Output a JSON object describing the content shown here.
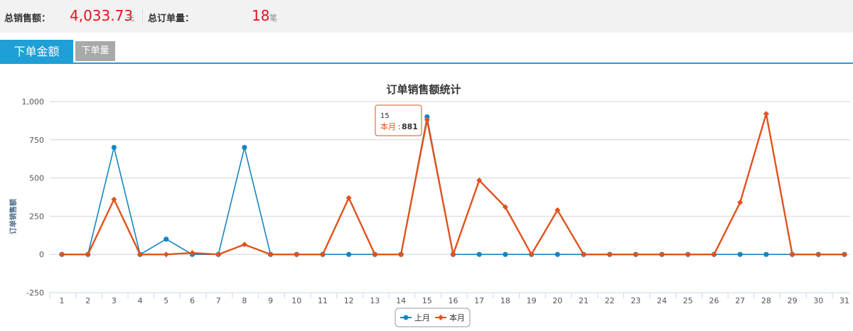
{
  "summary": {
    "total_sales_label": "总销售额：",
    "total_sales_value": "4,033.73",
    "total_sales_unit": "元",
    "total_orders_label": "总订单量：",
    "total_orders_value": "18",
    "total_orders_unit": "笔"
  },
  "tabs": {
    "amount": "下单金额",
    "count": "下单量"
  },
  "colors": {
    "last_month": "#1786c0",
    "this_month": "#e2521d",
    "accent": "#1e9fd6",
    "highlight": "#e0141c"
  },
  "tooltip": {
    "x": "15",
    "series": "本月",
    "value": "881"
  },
  "chart_data": {
    "type": "line",
    "title": "订单销售额统计",
    "ylabel": "订单销售额",
    "xlabel": "",
    "ylim": [
      -250,
      1000
    ],
    "yticks": [
      -250,
      0,
      250,
      500,
      750,
      1000
    ],
    "ytick_labels": [
      "-250",
      "0",
      "250",
      "500",
      "750",
      "1,000"
    ],
    "categories": [
      "1",
      "2",
      "3",
      "4",
      "5",
      "6",
      "7",
      "8",
      "9",
      "10",
      "11",
      "12",
      "13",
      "14",
      "15",
      "16",
      "17",
      "18",
      "19",
      "20",
      "21",
      "22",
      "23",
      "24",
      "25",
      "26",
      "27",
      "28",
      "29",
      "30",
      "31"
    ],
    "grid": true,
    "legend_position": "bottom-center",
    "series": [
      {
        "name": "上月",
        "marker": "circle",
        "values": [
          0,
          0,
          700,
          0,
          100,
          0,
          0,
          700,
          0,
          0,
          0,
          0,
          0,
          0,
          900,
          0,
          0,
          0,
          0,
          0,
          0,
          0,
          0,
          0,
          0,
          0,
          0,
          0,
          0,
          0,
          0
        ]
      },
      {
        "name": "本月",
        "marker": "diamond",
        "values": [
          0,
          0,
          360,
          0,
          0,
          10,
          0,
          65,
          0,
          0,
          0,
          370,
          0,
          0,
          881,
          0,
          485,
          310,
          0,
          290,
          0,
          0,
          0,
          0,
          0,
          0,
          340,
          920,
          0,
          0,
          0
        ]
      }
    ]
  }
}
